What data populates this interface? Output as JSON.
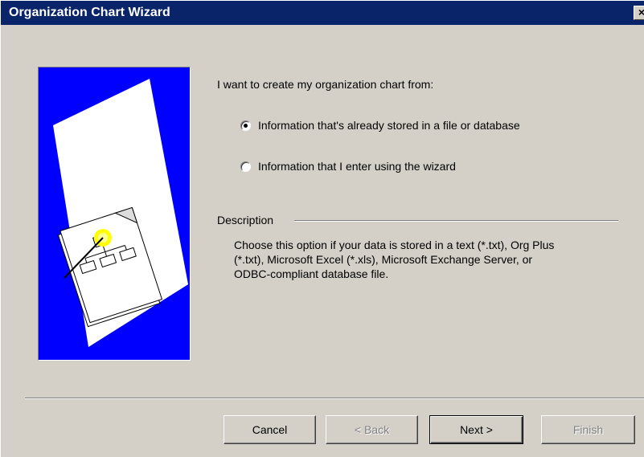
{
  "window": {
    "title": "Organization Chart Wizard",
    "close_glyph": "×"
  },
  "main": {
    "prompt": "I want to create my organization chart from:",
    "options": [
      {
        "label": "Information that's already stored in a file or database",
        "checked": true
      },
      {
        "label": "Information that I enter using the wizard",
        "checked": false
      }
    ],
    "description_label": "Description",
    "description_text": "Choose this option if your data is stored in a text (*.txt), Org Plus (*.txt), Microsoft Excel (*.xls), Microsoft Exchange Server, or ODBC-compliant database file."
  },
  "buttons": {
    "cancel": "Cancel",
    "back": "< Back",
    "next": "Next >",
    "finish": "Finish"
  },
  "colors": {
    "titlebar": "#0a246a",
    "illustration_background": "#0000ff",
    "dialog_background": "#d4d0c8"
  },
  "icons": {
    "illustration": "org-chart-document-with-magic-wand-illustration",
    "close": "close-icon"
  }
}
